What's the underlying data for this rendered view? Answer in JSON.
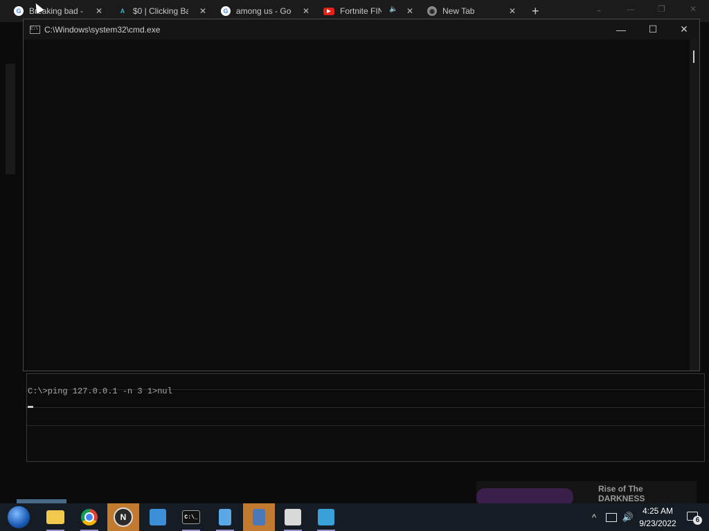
{
  "browser": {
    "tabs": [
      {
        "title": "Breaking bad -",
        "favicon": "google-icon",
        "favicon_text": "G"
      },
      {
        "title": "$0 | Clicking Ba",
        "favicon": "site-logo-icon",
        "favicon_text": "A"
      },
      {
        "title": "among us - Goo",
        "favicon": "google-icon",
        "favicon_text": "G"
      },
      {
        "title": "Fortnite FIN",
        "favicon": "youtube-icon",
        "favicon_text": "▶"
      },
      {
        "title": "New Tab",
        "favicon": "chrome-icon",
        "favicon_text": "◉"
      }
    ],
    "close_glyph": "✕",
    "mute_glyph": "🔈",
    "new_tab_glyph": "+"
  },
  "cmd_window": {
    "title": "C:\\Windows\\system32\\cmd.exe",
    "icon_text": "C:\\",
    "minimize_glyph": "—",
    "maximize_glyph": "☐",
    "close_glyph": "✕"
  },
  "background_console": {
    "command_line": "C:\\>ping 127.0.0.1 -n 3  1>nul"
  },
  "promo": {
    "title": "Rise of The DARKNESS"
  },
  "taskbar": {
    "items": [
      {
        "name": "start-button",
        "icon": "windows-orb-icon"
      },
      {
        "name": "file-explorer",
        "icon": "folder-icon",
        "color": "#f2c94c"
      },
      {
        "name": "chrome",
        "icon": "chrome-icon",
        "color": "#e8e8e8"
      },
      {
        "name": "n-app",
        "icon": "n-logo-icon",
        "text": "N",
        "color": "#2a2a2a"
      },
      {
        "name": "app-blue",
        "icon": "blue-app-icon",
        "color": "#3c8fd6"
      },
      {
        "name": "terminal",
        "icon": "terminal-icon",
        "text": "C:\\_",
        "color": "#111111"
      },
      {
        "name": "notepad",
        "icon": "notepad-icon",
        "color": "#5aa9e6"
      },
      {
        "name": "calculator",
        "icon": "calculator-icon",
        "color": "#4a78b8"
      },
      {
        "name": "app-white",
        "icon": "white-app-icon",
        "color": "#d9d9d9"
      },
      {
        "name": "media-player",
        "icon": "media-player-icon",
        "color": "#3aa0d8"
      }
    ],
    "clock_time": "4:25 AM",
    "clock_date": "9/23/2022",
    "notification_count": "6",
    "tray_chevron": "^",
    "volume_glyph": "🔊"
  },
  "colors": {
    "taskbar_active": "#c27a2e",
    "console_bg": "#0c0c0c"
  }
}
